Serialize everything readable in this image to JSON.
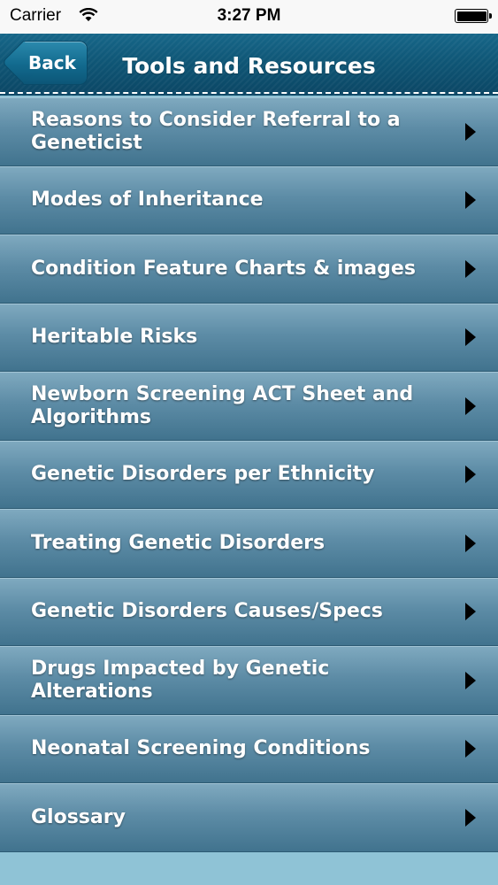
{
  "status_bar": {
    "carrier": "Carrier",
    "time": "3:27 PM"
  },
  "nav": {
    "back_label": "Back",
    "title": "Tools and Resources"
  },
  "menu": {
    "items": [
      {
        "label": "Reasons to Consider Referral to a Geneticist"
      },
      {
        "label": "Modes of Inheritance"
      },
      {
        "label": "Condition Feature Charts & images"
      },
      {
        "label": "Heritable Risks"
      },
      {
        "label": "Newborn Screening ACT Sheet and Algorithms"
      },
      {
        "label": "Genetic Disorders per Ethnicity"
      },
      {
        "label": "Treating Genetic Disorders"
      },
      {
        "label": "Genetic Disorders Causes/Specs"
      },
      {
        "label": "Drugs Impacted by Genetic Alterations"
      },
      {
        "label": "Neonatal Screening Conditions"
      },
      {
        "label": "Glossary"
      }
    ]
  },
  "icons": {
    "wifi": "wifi-icon",
    "battery": "battery-icon",
    "chevron": "chevron-right-icon",
    "back": "back-chevron-icon"
  },
  "colors": {
    "nav_background": "#0f5676",
    "row_background": "#5d8ca6",
    "footer_background": "#8fc3d6"
  }
}
